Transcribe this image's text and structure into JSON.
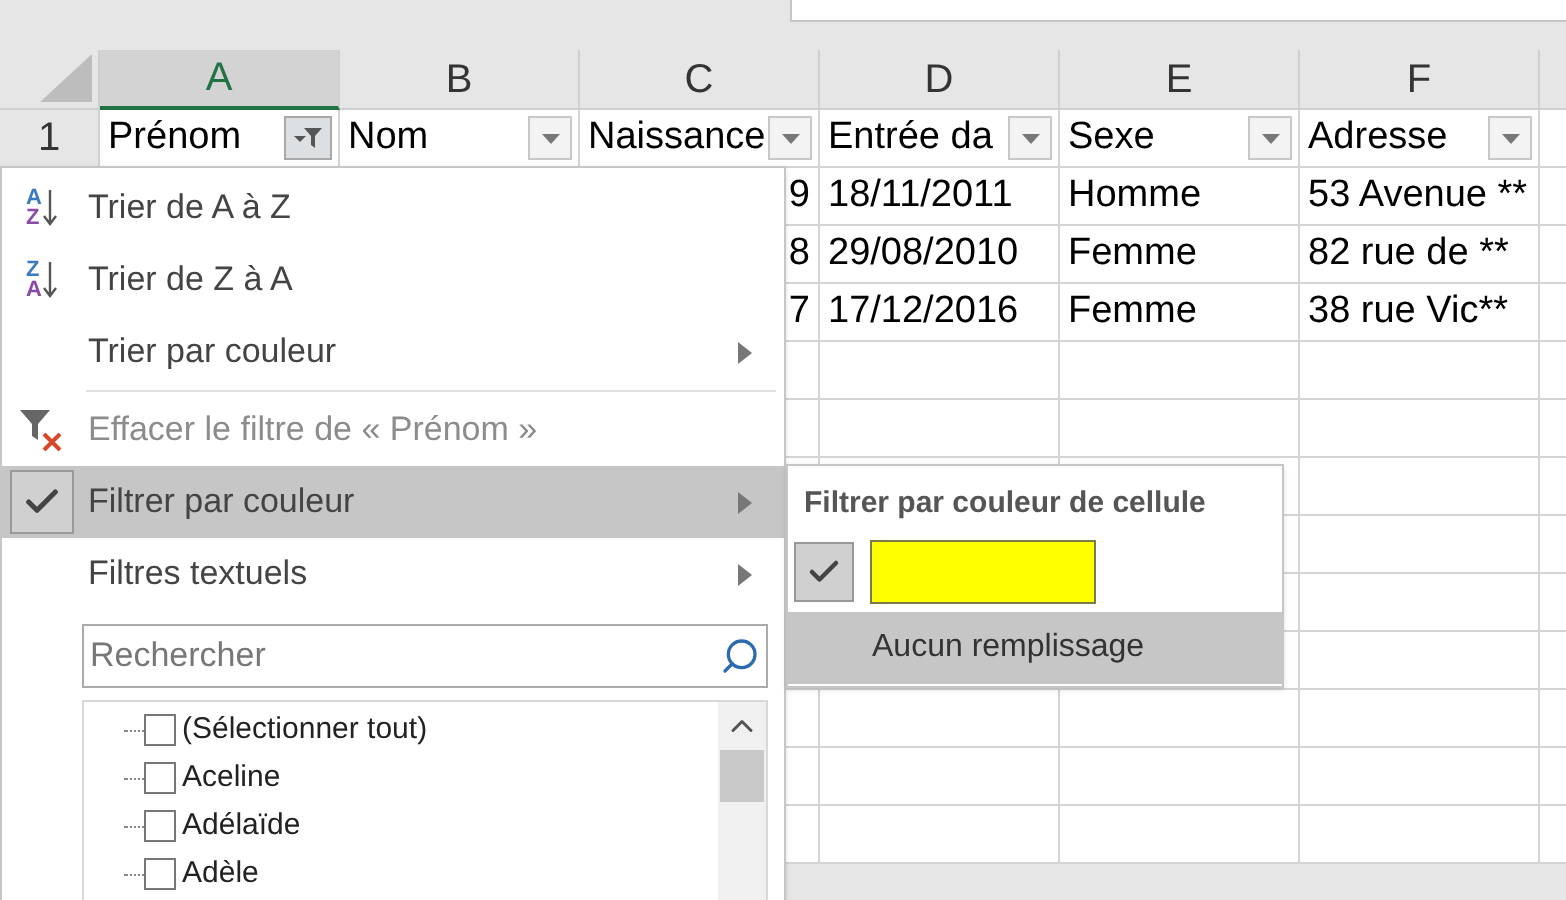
{
  "columns": [
    {
      "letter": "A",
      "title": "Prénom",
      "selected": true,
      "filter_active": true
    },
    {
      "letter": "B",
      "title": "Nom",
      "selected": false,
      "filter_active": false
    },
    {
      "letter": "C",
      "title": "Naissance",
      "selected": false,
      "filter_active": false
    },
    {
      "letter": "D",
      "title": "Entrée da",
      "selected": false,
      "filter_active": false
    },
    {
      "letter": "E",
      "title": "Sexe",
      "selected": false,
      "filter_active": false
    },
    {
      "letter": "F",
      "title": "Adresse",
      "selected": false,
      "filter_active": false
    }
  ],
  "header_row_number": "1",
  "rows": [
    [
      "",
      "",
      "9",
      "18/11/2011",
      "Homme",
      "53 Avenue **"
    ],
    [
      "",
      "",
      "8",
      "29/08/2010",
      "Femme",
      "82 rue de **"
    ],
    [
      "",
      "",
      "7",
      "17/12/2016",
      "Femme",
      "38 rue Vic**"
    ]
  ],
  "filter_menu": {
    "items": [
      {
        "kind": "sort",
        "icon_top": "A",
        "icon_bottom": "Z",
        "label": "Trier de A à Z",
        "disabled": false,
        "selected": false,
        "checked": false,
        "submenu": false
      },
      {
        "kind": "sort",
        "icon_top": "Z",
        "icon_bottom": "A",
        "label": "Trier de Z à A",
        "disabled": false,
        "selected": false,
        "checked": false,
        "submenu": false
      },
      {
        "kind": "plain",
        "label": "Trier par couleur",
        "disabled": false,
        "selected": false,
        "checked": false,
        "submenu": true
      },
      {
        "kind": "divider"
      },
      {
        "kind": "clear",
        "label": "Effacer le filtre de « Prénom »",
        "disabled": true,
        "selected": false,
        "checked": false,
        "submenu": false
      },
      {
        "kind": "plain",
        "label": "Filtrer par couleur",
        "disabled": false,
        "selected": true,
        "checked": true,
        "submenu": true
      },
      {
        "kind": "plain",
        "label": "Filtres textuels",
        "disabled": false,
        "selected": false,
        "checked": false,
        "submenu": true
      }
    ],
    "search": {
      "placeholder": "Rechercher"
    },
    "values": [
      {
        "label": "(Sélectionner tout)",
        "checked": false
      },
      {
        "label": "Aceline",
        "checked": false
      },
      {
        "label": "Adélaïde",
        "checked": false
      },
      {
        "label": "Adèle",
        "checked": false
      }
    ]
  },
  "color_submenu": {
    "title": "Filtrer par couleur de cellule",
    "colors": [
      {
        "color": "#ffff00",
        "checked": true
      }
    ],
    "no_fill": {
      "label": "Aucun remplissage",
      "selected": true
    }
  }
}
